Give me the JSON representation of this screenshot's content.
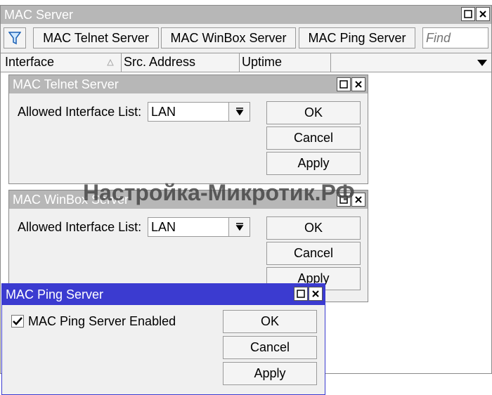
{
  "main_window": {
    "title": "MAC Server",
    "toolbar": {
      "mac_telnet_label": "MAC Telnet Server",
      "mac_winbox_label": "MAC WinBox Server",
      "mac_ping_label": "MAC Ping Server",
      "find_placeholder": "Find"
    },
    "columns": [
      "Interface",
      "Src. Address",
      "Uptime"
    ]
  },
  "telnet_dialog": {
    "title": "MAC Telnet Server",
    "field_label": "Allowed Interface List:",
    "field_value": "LAN",
    "ok_label": "OK",
    "cancel_label": "Cancel",
    "apply_label": "Apply"
  },
  "winbox_dialog": {
    "title": "MAC WinBox Server",
    "field_label": "Allowed Interface List:",
    "field_value": "LAN",
    "ok_label": "OK",
    "cancel_label": "Cancel",
    "apply_label": "Apply"
  },
  "ping_dialog": {
    "title": "MAC Ping Server",
    "checkbox_label": "MAC Ping Server Enabled",
    "checkbox_checked": true,
    "ok_label": "OK",
    "cancel_label": "Cancel",
    "apply_label": "Apply"
  },
  "watermark": {
    "text": "Настройка-Микротик.РФ"
  },
  "colors": {
    "inactive_title": "#b7b7b7",
    "active_title": "#3b3bd0",
    "window_bg": "#f0f0f0"
  }
}
